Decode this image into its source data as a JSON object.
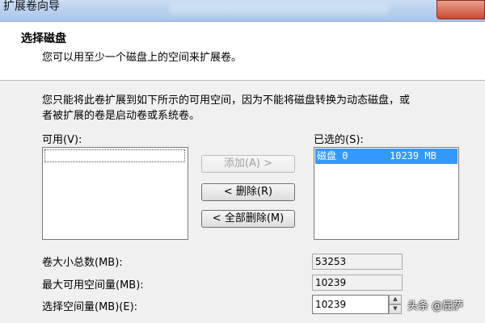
{
  "window": {
    "title": "扩展卷向导"
  },
  "header": {
    "title": "选择磁盘",
    "subtitle": "您可以用至少一个磁盘上的空间来扩展卷。"
  },
  "description": {
    "line1": "您只能将此卷扩展到如下所示的可用空间，因为不能将磁盘转换为动态磁盘，或",
    "line2": "者被扩展的卷是启动卷或系统卷。"
  },
  "available": {
    "label": "可用(V):"
  },
  "selected": {
    "label": "已选的(S):",
    "items": [
      {
        "disk": "磁盘 0",
        "size": "10239 MB"
      }
    ]
  },
  "buttons": {
    "add": "添加(A) >",
    "remove": "< 删除(R)",
    "remove_all": "< 全部删除(M)"
  },
  "fields": {
    "total_label": "卷大小总数(MB):",
    "total_value": "53253",
    "max_label": "最大可用空间量(MB):",
    "max_value": "10239",
    "choose_label": "选择空间量(MB)(E):",
    "choose_value": "10239"
  },
  "watermark": "头条 @屁萨",
  "icons": {
    "spin_up": "▲",
    "spin_down": "▼"
  }
}
